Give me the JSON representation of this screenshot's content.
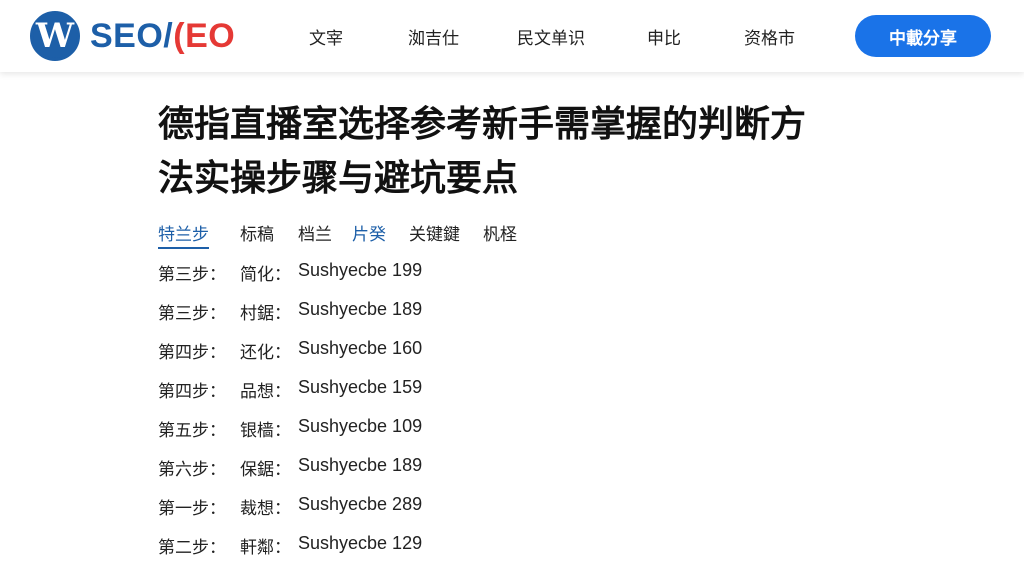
{
  "brand": {
    "mark": "W",
    "name_blue": "SEO/",
    "name_red": "(EO"
  },
  "nav": {
    "items": [
      {
        "label": "文宰"
      },
      {
        "label": "洳吉仕"
      },
      {
        "label": "民文单识"
      },
      {
        "label": "申比"
      },
      {
        "label": "资格市"
      }
    ],
    "cta_label": "中載分享"
  },
  "article": {
    "title_line1": "德指直播室选择参考新手需掌握的判断方",
    "title_line2": "法实操步骤与避坑要点",
    "tabs": [
      {
        "label": "特兰步",
        "active": true
      },
      {
        "label": "标稿"
      },
      {
        "label": "档兰"
      },
      {
        "label": "片癸"
      },
      {
        "label": "关键鍵"
      },
      {
        "label": "杋柽"
      }
    ],
    "rows": [
      {
        "step": "第三步：",
        "label": "简化：",
        "value": "Sushyecbe 199"
      },
      {
        "step": "第三步：",
        "label": "村鋸：",
        "value": "Sushyecbe 189"
      },
      {
        "step": "第四步：",
        "label": "还化：",
        "value": "Sushyecbe 160"
      },
      {
        "step": "第四步：",
        "label": "品想：",
        "value": "Sushyecbe 159"
      },
      {
        "step": "第五步：",
        "label": "银樯：",
        "value": "Sushyecbe 109"
      },
      {
        "step": "第六步：",
        "label": "保鋸：",
        "value": "Sushyecbe 189"
      },
      {
        "step": "第一步：",
        "label": "裁想：",
        "value": "Sushyecbe 289"
      },
      {
        "step": "第二步：",
        "label": "軒鄰：",
        "value": "Sushyecbe 129"
      }
    ]
  },
  "colors": {
    "brand_blue": "#1d5fa8",
    "brand_red": "#e53935",
    "cta_blue": "#1a73e8"
  }
}
